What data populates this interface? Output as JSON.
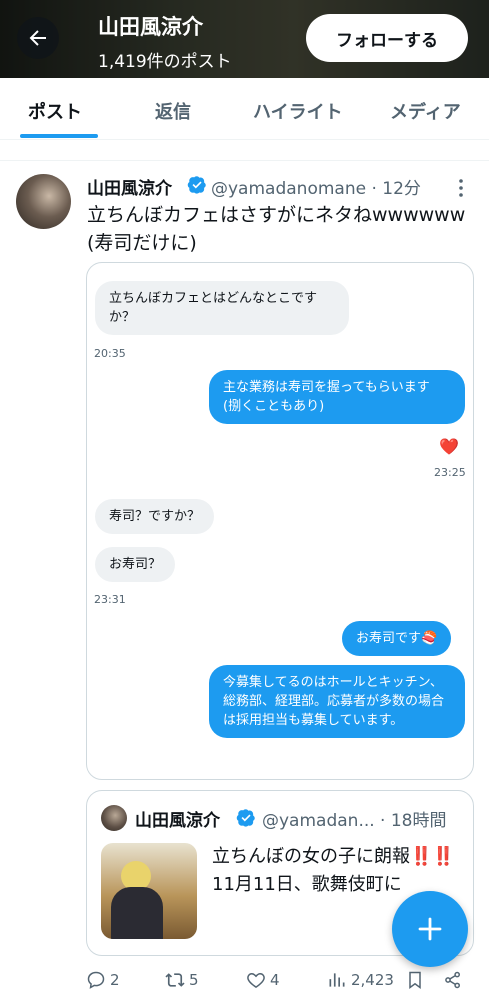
{
  "header": {
    "title": "山田風涼介",
    "subtitle": "1,419件のポスト",
    "back_icon": "arrow-left-icon",
    "follow_label": "フォローする"
  },
  "tabs": [
    {
      "label": "ポスト",
      "active": true
    },
    {
      "label": "返信",
      "active": false
    },
    {
      "label": "ハイライト",
      "active": false
    },
    {
      "label": "メディア",
      "active": false
    }
  ],
  "tweet": {
    "author": "山田風涼介",
    "handle_time": "@yamadanomane · 12分",
    "text": "立ちんぼカフェはさすがにネタねwwwwww (寿司だけに)",
    "media": {
      "messages": [
        {
          "dir": "in",
          "text": "立ちんぼカフェとはどんなとこですか？",
          "time": "20:35"
        },
        {
          "dir": "out",
          "text": "主な業務は寿司を握ってもらいます (捌くこともあり)"
        },
        {
          "reaction": "❤️",
          "time": "23:25"
        },
        {
          "dir": "in",
          "text": "寿司？ですか？"
        },
        {
          "dir": "in",
          "text": "お寿司？",
          "time": "23:31"
        },
        {
          "dir": "out",
          "text": "お寿司です🍣"
        },
        {
          "dir": "out",
          "text": "今募集してるのはホールとキッチン、総務部、経理部。応募者が多数の場合は採用担当も募集しています。"
        }
      ]
    }
  },
  "quote": {
    "author": "山田風涼介",
    "handle_time": "@yamadan... · 18時間",
    "text_line1": "立ちんぼの女の子に朗報",
    "alarm": "‼️‼️",
    "text_line2": "11月11日、歌舞伎町に"
  },
  "actions": {
    "replies": "2",
    "reposts": "5",
    "likes": "4",
    "views": "2,423"
  },
  "colors": {
    "accent": "#1d9bf0",
    "text": "#0f1419",
    "muted": "#536471",
    "alarm": "#e0245e"
  }
}
